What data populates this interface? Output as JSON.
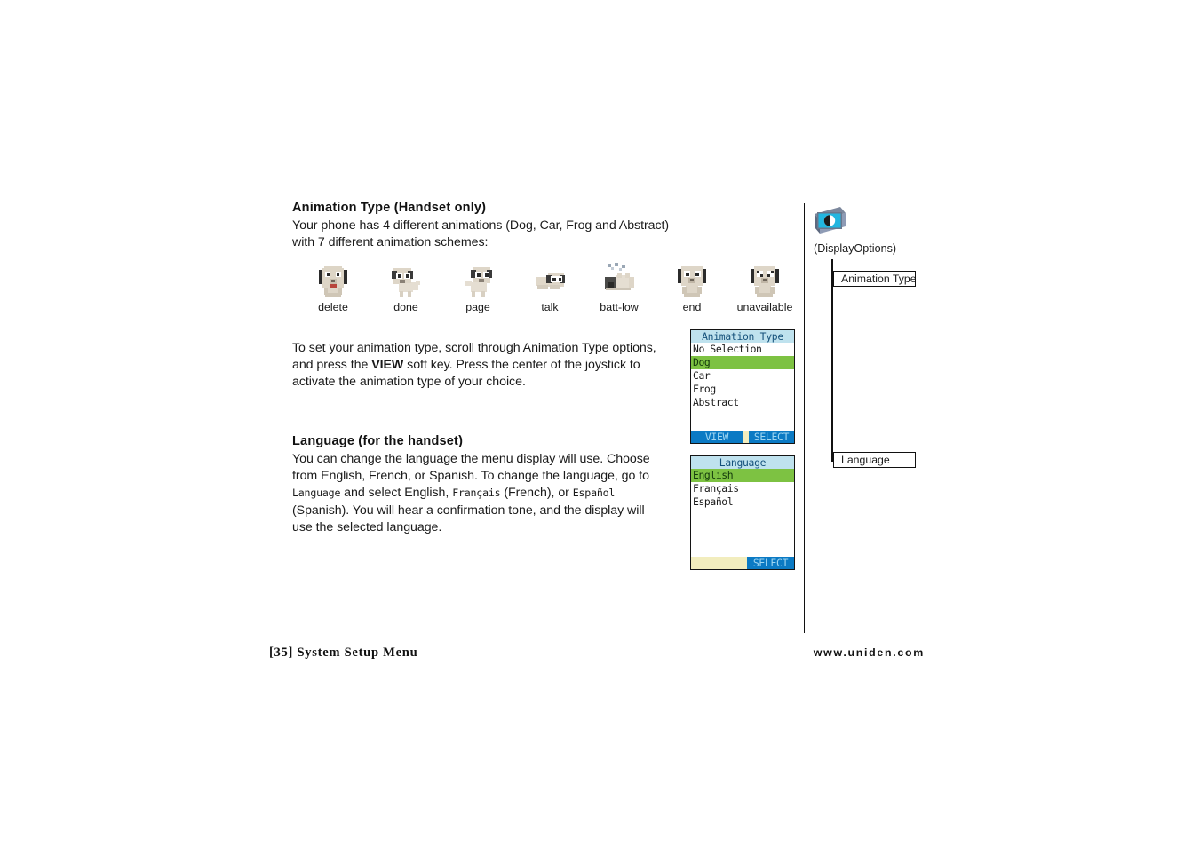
{
  "page": {
    "background": "#ffffff",
    "divider_color": "#111111"
  },
  "sections": {
    "animation": {
      "heading": "Animation Type (Handset only)",
      "intro_before": "Your phone has 4 different animations (Dog, Car, Frog and Abstract) with 7 different animation schemes:",
      "instructions_part1": "To set your animation type, scroll through Animation Type options, and press the ",
      "instructions_bold": "VIEW",
      "instructions_part2": " soft key. Press the center of the joystick to activate the animation type of your choice."
    },
    "language": {
      "heading": "Language (for the handset)",
      "para_part1": "You can change the language the menu display will use. Choose from English, French, or Spanish. To change the language, go to ",
      "lcd_language": "Language",
      "para_part2": " and select English, ",
      "lcd_francais": "Français",
      "para_part3": " (French), or ",
      "lcd_espanol": "Español",
      "para_part4": " (Spanish). You will hear a confirmation tone, and the display will use the selected language."
    }
  },
  "sprites": [
    {
      "label": "delete",
      "pose": "sit-headphones",
      "icon_name": "dog-delete-icon"
    },
    {
      "label": "done",
      "pose": "stand-side",
      "icon_name": "dog-done-icon"
    },
    {
      "label": "page",
      "pose": "stand-front",
      "icon_name": "dog-page-icon"
    },
    {
      "label": "talk",
      "pose": "lying-stretch",
      "icon_name": "dog-talk-icon"
    },
    {
      "label": "batt-low",
      "pose": "sleeping-stars",
      "icon_name": "dog-batt-low-icon"
    },
    {
      "label": "end",
      "pose": "sit-headphones",
      "icon_name": "dog-end-icon"
    },
    {
      "label": "unavailable",
      "pose": "sit-headphones-x",
      "icon_name": "dog-unavailable-icon"
    }
  ],
  "lcd_screens": {
    "animation_type": {
      "title": "Animation Type",
      "rows": [
        {
          "text": "No Selection",
          "selected": false
        },
        {
          "text": "Dog",
          "selected": true
        },
        {
          "text": "Car",
          "selected": false
        },
        {
          "text": "Frog",
          "selected": false
        },
        {
          "text": "Abstract",
          "selected": false
        }
      ],
      "softkeys": [
        {
          "label": "VIEW",
          "style": "blue"
        },
        {
          "label": "",
          "style": "pale"
        },
        {
          "label": "SELECT",
          "style": "blue"
        }
      ],
      "colors": {
        "title_bg": "#bfe2ee",
        "title_fg": "#14507a",
        "selected_bg": "#7dc242",
        "softkey_bg": "#0b7ac4",
        "softkey_fg": "#9fd6f2",
        "gap_bg": "#f2edbe"
      }
    },
    "language": {
      "title": "Language",
      "rows": [
        {
          "text": "English",
          "selected": true
        },
        {
          "text": "Français",
          "selected": false
        },
        {
          "text": "Español",
          "selected": false
        }
      ],
      "softkeys": [
        {
          "label": "",
          "style": "pale"
        },
        {
          "label": "SELECT",
          "style": "blue"
        }
      ],
      "colors": {
        "title_bg": "#bfe2ee",
        "title_fg": "#14507a",
        "selected_bg": "#7dc242",
        "softkey_bg": "#0b7ac4",
        "softkey_fg": "#9fd6f2",
        "gap_bg": "#f2edbe"
      }
    }
  },
  "menu_tree": {
    "icon_name": "display-options-icon",
    "icon_colors": {
      "screen": "#22b6e0",
      "frame": "#8e9bb5",
      "shadow": "#5a6477"
    },
    "root_caption": "(DisplayOptions)",
    "items": [
      {
        "label": "Animation Type"
      },
      {
        "label": "Language"
      }
    ]
  },
  "footer": {
    "left": "[35] System Setup Menu",
    "right": "www.uniden.com"
  }
}
